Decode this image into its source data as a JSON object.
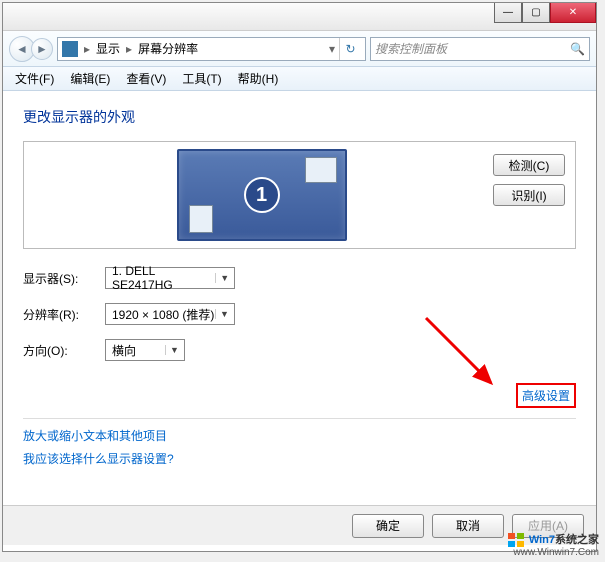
{
  "titlebar": {
    "min": "—",
    "max": "▢",
    "close": "✕"
  },
  "address": {
    "item1": "显示",
    "item2": "屏幕分辨率",
    "search_placeholder": "搜索控制面板"
  },
  "menu": {
    "file": "文件(F)",
    "edit": "编辑(E)",
    "view": "查看(V)",
    "tools": "工具(T)",
    "help": "帮助(H)"
  },
  "content": {
    "heading": "更改显示器的外观",
    "detect_btn": "检测(C)",
    "identify_btn": "识别(I)",
    "monitor_number": "1",
    "display_label": "显示器(S):",
    "display_value": "1. DELL SE2417HG",
    "resolution_label": "分辨率(R):",
    "resolution_value": "1920 × 1080 (推荐)",
    "orientation_label": "方向(O):",
    "orientation_value": "横向",
    "advanced_link": "高级设置",
    "textsize_link": "放大或缩小文本和其他项目",
    "which_settings_link": "我应该选择什么显示器设置?"
  },
  "buttons": {
    "ok": "确定",
    "cancel": "取消",
    "apply": "应用(A)"
  },
  "watermark": {
    "brand_zh": "系统之家",
    "url": "www.Winwin7.Com"
  }
}
